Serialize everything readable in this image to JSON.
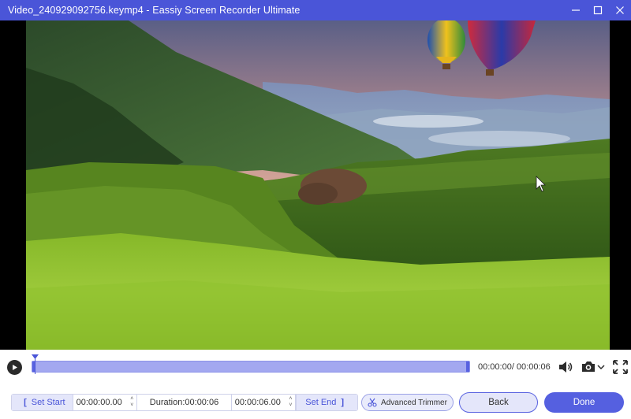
{
  "window": {
    "title": "Video_240929092756.keymp4  -  Eassiy Screen Recorder Ultimate",
    "controls": [
      "minimize-icon",
      "maximize-icon",
      "close-icon"
    ]
  },
  "video": {
    "description_icon": "landscape-preview",
    "cursor_icon": "mouse-pointer-icon"
  },
  "playback": {
    "time_readout": "00:00:00/ 00:00:06",
    "progress": 0.0,
    "icons": [
      "play-icon",
      "volume-icon",
      "camera-icon",
      "chevron-down-icon",
      "fullscreen-icon"
    ]
  },
  "trim": {
    "set_start_label": "Set Start",
    "start_time": "00:00:00.00",
    "duration_label": "Duration:00:00:06",
    "end_time": "00:00:06.00",
    "set_end_label": "Set End",
    "advanced_trimmer_label": "Advanced Trimmer"
  },
  "actions": {
    "back_label": "Back",
    "done_label": "Done"
  },
  "colors": {
    "accent": "#4a55d8",
    "button_primary": "#5560e0",
    "timeline": "#a3a8f0"
  }
}
